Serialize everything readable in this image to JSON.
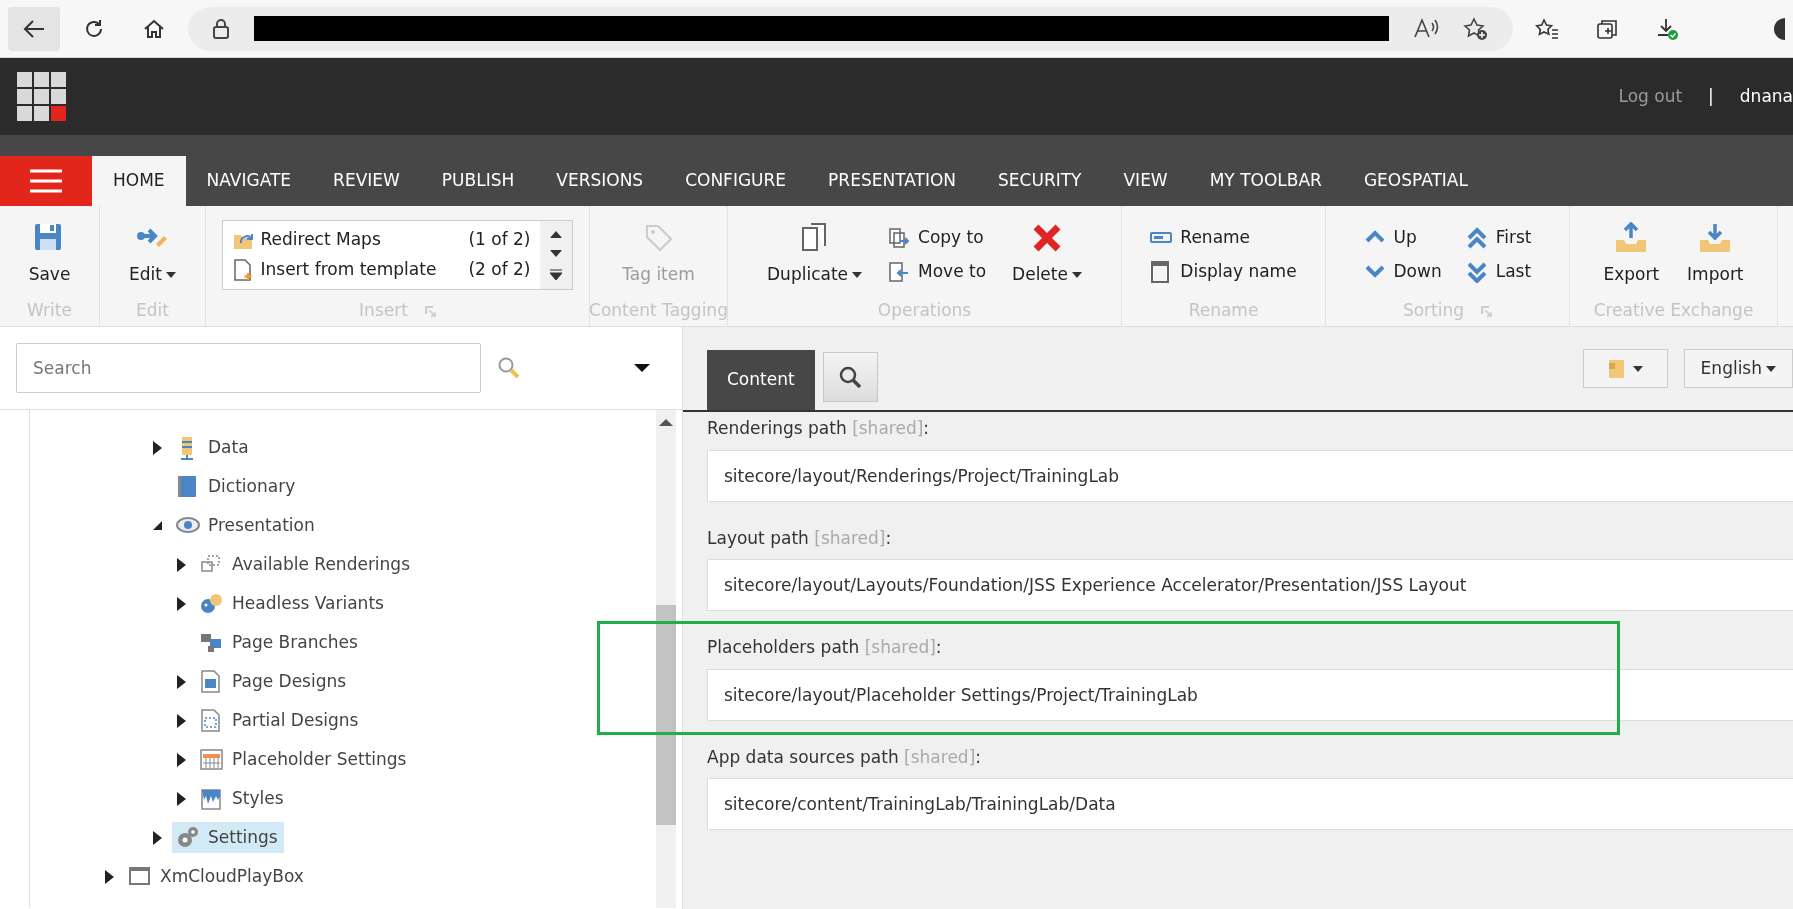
{
  "header": {
    "logout": "Log out",
    "separator": "|",
    "user": "dnana"
  },
  "menu_tabs": [
    {
      "label": "HOME",
      "selected": true
    },
    {
      "label": "NAVIGATE",
      "selected": false
    },
    {
      "label": "REVIEW",
      "selected": false
    },
    {
      "label": "PUBLISH",
      "selected": false
    },
    {
      "label": "VERSIONS",
      "selected": false
    },
    {
      "label": "CONFIGURE",
      "selected": false
    },
    {
      "label": "PRESENTATION",
      "selected": false
    },
    {
      "label": "SECURITY",
      "selected": false
    },
    {
      "label": "VIEW",
      "selected": false
    },
    {
      "label": "MY TOOLBAR",
      "selected": false
    },
    {
      "label": "GEOSPATIAL",
      "selected": false
    }
  ],
  "ribbon": [
    {
      "caption": "Write",
      "items": [
        {
          "kind": "large",
          "label": "Save",
          "dropdown": false,
          "disabled": false
        }
      ]
    },
    {
      "caption": "Edit",
      "items": [
        {
          "kind": "large",
          "label": "Edit",
          "dropdown": true,
          "disabled": false
        }
      ]
    },
    {
      "caption": "Insert",
      "items": [
        {
          "kind": "gallery",
          "entries": [
            {
              "label": "Redirect Maps",
              "count": "(1 of 2)"
            },
            {
              "label": "Insert from template",
              "count": "(2 of 2)"
            }
          ]
        },
        {
          "kind": "launcher"
        }
      ]
    },
    {
      "caption": "Content Tagging",
      "items": [
        {
          "kind": "large",
          "label": "Tag item",
          "dropdown": false,
          "disabled": true
        }
      ]
    },
    {
      "caption": "Operations",
      "items": [
        {
          "kind": "large",
          "label": "Duplicate",
          "dropdown": true,
          "disabled": false
        },
        {
          "kind": "small",
          "label": "Copy to",
          "dropdown": false,
          "disabled": false
        },
        {
          "kind": "small",
          "label": "Move to",
          "dropdown": false,
          "disabled": false
        },
        {
          "kind": "large",
          "label": "Delete",
          "dropdown": true,
          "disabled": false
        }
      ]
    },
    {
      "caption": "Rename",
      "items": [
        {
          "kind": "small",
          "label": "Rename",
          "dropdown": false,
          "disabled": false
        },
        {
          "kind": "small",
          "label": "Display name",
          "dropdown": false,
          "disabled": false
        }
      ]
    },
    {
      "caption": "Sorting",
      "items": [
        {
          "kind": "small",
          "label": "Up",
          "dropdown": false,
          "disabled": false
        },
        {
          "kind": "small",
          "label": "Down",
          "dropdown": false,
          "disabled": false
        },
        {
          "kind": "small",
          "label": "First",
          "dropdown": false,
          "disabled": false
        },
        {
          "kind": "small",
          "label": "Last",
          "dropdown": false,
          "disabled": false
        },
        {
          "kind": "launcher"
        }
      ]
    },
    {
      "caption": "Creative Exchange",
      "items": [
        {
          "kind": "large",
          "label": "Export",
          "dropdown": false,
          "disabled": false
        },
        {
          "kind": "large",
          "label": "Import",
          "dropdown": false,
          "disabled": false
        }
      ]
    }
  ],
  "search": {
    "placeholder": "Search"
  },
  "tree": [
    {
      "children": [
        {
          "label": "Data",
          "expanded": false,
          "selected": false
        },
        {
          "label": "Dictionary",
          "selected": false
        },
        {
          "label": "Presentation",
          "expanded": true,
          "selected": false,
          "children": [
            {
              "label": "Available Renderings",
              "expanded": false,
              "selected": false
            },
            {
              "label": "Headless Variants",
              "expanded": false,
              "selected": false
            },
            {
              "label": "Page Branches",
              "selected": false
            },
            {
              "label": "Page Designs",
              "expanded": false,
              "selected": false
            },
            {
              "label": "Partial Designs",
              "expanded": false,
              "selected": false
            },
            {
              "label": "Placeholder Settings",
              "expanded": false,
              "selected": false
            },
            {
              "label": "Styles",
              "expanded": false,
              "selected": false
            }
          ]
        },
        {
          "label": "Settings",
          "expanded": false,
          "selected": true
        }
      ]
    },
    {
      "label": "XmCloudPlayBox",
      "expanded": false,
      "selected": false
    }
  ],
  "editor": {
    "tabs": [
      {
        "label": "Content",
        "selected": true
      }
    ],
    "language": "English",
    "fields": [
      {
        "label": "Renderings path",
        "note": "[shared]",
        "colon": ":",
        "value": "sitecore/layout/Renderings/Project/TrainingLab",
        "highlighted": false
      },
      {
        "label": "Layout path",
        "note": "[shared]",
        "colon": ":",
        "value": "sitecore/layout/Layouts/Foundation/JSS Experience Accelerator/Presentation/JSS Layout",
        "highlighted": false
      },
      {
        "label": "Placeholders path",
        "note": "[shared]",
        "colon": ":",
        "value": "sitecore/layout/Placeholder Settings/Project/TrainingLab",
        "highlighted": true
      },
      {
        "label": "App data sources path",
        "note": "[shared]",
        "colon": ":",
        "value": "sitecore/content/TrainingLab/TrainingLab/Data",
        "highlighted": false
      }
    ]
  }
}
